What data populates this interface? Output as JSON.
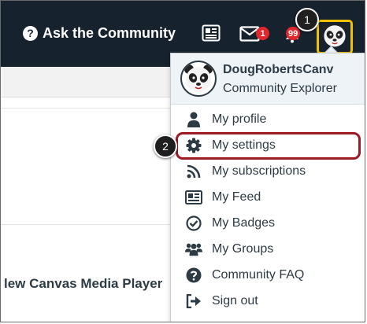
{
  "topbar": {
    "ask_label": "Ask the Community",
    "question_glyph": "?",
    "notifications_count": "1",
    "alerts_count": "99",
    "icons": [
      "question-circle-icon",
      "newspaper-icon",
      "envelope-icon",
      "bell-icon",
      "panda-avatar-icon"
    ]
  },
  "steps": {
    "one": "1",
    "two": "2"
  },
  "content": {
    "player_title": "lew Canvas Media Player"
  },
  "menu": {
    "profile": {
      "name": "DougRobertsCanv",
      "rank": "Community Explorer"
    },
    "items": [
      {
        "label": "My profile",
        "icon": "user-icon"
      },
      {
        "label": "My settings",
        "icon": "gear-icon"
      },
      {
        "label": "My subscriptions",
        "icon": "rss-icon"
      },
      {
        "label": "My Feed",
        "icon": "feed-icon"
      },
      {
        "label": "My Badges",
        "icon": "badge-check-icon"
      },
      {
        "label": "My Groups",
        "icon": "users-icon"
      },
      {
        "label": "Community FAQ",
        "icon": "question-circle-icon"
      },
      {
        "label": "Sign out",
        "icon": "sign-out-icon"
      }
    ]
  },
  "colors": {
    "topbar": "#16222e",
    "badge": "#e1262c",
    "avatar_highlight": "#f2c100",
    "settings_highlight": "#9b1a24",
    "text": "#2d3b45"
  }
}
